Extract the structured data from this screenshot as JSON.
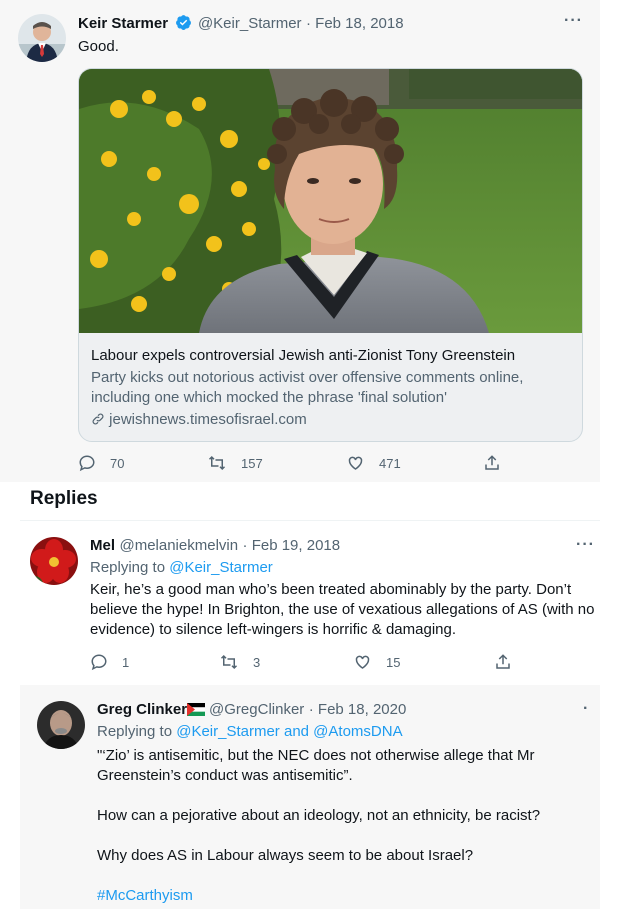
{
  "tweet": {
    "author_name": "Keir Starmer",
    "author_handle": "@Keir_Starmer",
    "date": "· Feb 18, 2018",
    "text": "Good.",
    "card": {
      "title": "Labour expels controversial Jewish anti-Zionist Tony Greenstein",
      "description_line1": "Party kicks out notorious activist over offensive comments online,",
      "description_line2": "including one which mocked the phrase 'final solution'",
      "domain": "jewishnews.timesofisrael.com"
    },
    "reply_count": "70",
    "retweet_count": "157",
    "like_count": "471"
  },
  "replies_heading": "Replies",
  "reply1": {
    "author_name": "Mel",
    "author_handle": "@melaniekmelvin",
    "date": "· Feb 19, 2018",
    "replying_to_prefix": "Replying to ",
    "replying_to": "@Keir_Starmer",
    "text_line1": "Keir, he’s a good man who’s been treated abominably by the party. Don’t",
    "text_line2": "believe the hype! In Brighton, the use of vexatious allegations of AS (with no",
    "text_line3": "evidence) to silence left-wingers is horrific & damaging.",
    "reply_count": "1",
    "retweet_count": "3",
    "like_count": "15"
  },
  "reply2": {
    "author_name": "Greg Clinker",
    "author_handle": "@GregClinker",
    "date": "· Feb 18, 2020",
    "replying_to_prefix": "Replying to ",
    "replying_to": "@Keir_Starmer and @AtomsDNA",
    "para1_line1": "\"‘Zio’ is antisemitic, but the NEC does not otherwise allege that Mr",
    "para1_line2": "Greenstein’s conduct was antisemitic”.",
    "para2": "How can a pejorative about an ideology, not an ethnicity, be racist?",
    "para3": "Why does AS in Labour always  seem to be about Israel?",
    "hashtag": "#McCarthyism"
  },
  "colors": {
    "accent": "#1d9bf0",
    "secondary_text": "#536471",
    "panel_bg": "#f7f7f7"
  },
  "icons": [
    "verified-badge-icon",
    "more-options-icon",
    "reply-icon",
    "retweet-icon",
    "like-icon",
    "share-icon",
    "link-icon",
    "flag-icon"
  ]
}
